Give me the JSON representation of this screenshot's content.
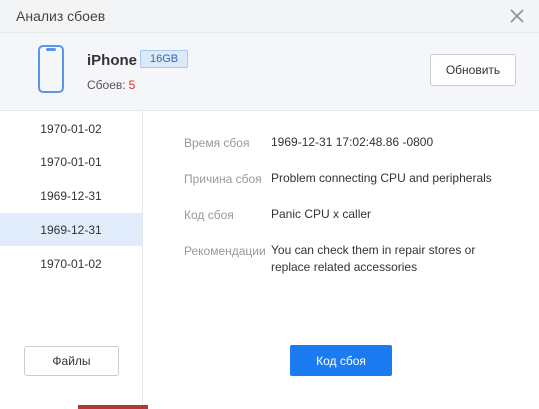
{
  "window": {
    "title": "Анализ сбоев"
  },
  "device": {
    "name": "iPhone",
    "capacity": "16GB",
    "crashes_label": "Сбоев:",
    "crashes_count": "5",
    "refresh_label": "Обновить"
  },
  "sidebar": {
    "dates": [
      {
        "label": "1970-01-02",
        "selected": false
      },
      {
        "label": "1970-01-01",
        "selected": false
      },
      {
        "label": "1969-12-31",
        "selected": false
      },
      {
        "label": "1969-12-31",
        "selected": true
      },
      {
        "label": "1970-01-02",
        "selected": false
      }
    ],
    "files_label": "Файлы"
  },
  "details": {
    "time_label": "Время сбоя",
    "time_value": "1969-12-31 17:02:48.86 -0800",
    "reason_label": "Причина сбоя",
    "reason_value": "Problem connecting CPU and peripherals",
    "code_label": "Код сбоя",
    "code_value": "Panic CPU x caller",
    "rec_label": "Рекомендации",
    "rec_value": "You can check them in repair stores or replace related accessories"
  },
  "actions": {
    "crash_code_label": "Код сбоя"
  },
  "colors": {
    "accent": "#1b7cf2",
    "selected_bg": "#e1ecfa",
    "alert": "#e0312c",
    "badge_bg": "#dbe9f9"
  }
}
